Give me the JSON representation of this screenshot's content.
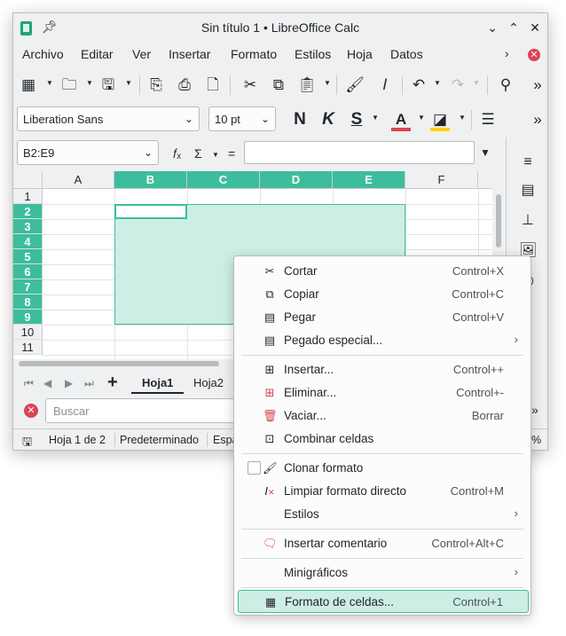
{
  "window": {
    "title": "Sin título 1 • LibreOffice Calc"
  },
  "menubar": {
    "items": [
      "Archivo",
      "Editar",
      "Ver",
      "Insertar",
      "Formato",
      "Estilos",
      "Hoja",
      "Datos"
    ]
  },
  "toolbar2": {
    "font_name": "Liberation Sans",
    "font_size": "10 pt"
  },
  "formulabar": {
    "name_box": "B2:E9",
    "formula": ""
  },
  "grid": {
    "columns": [
      "A",
      "B",
      "C",
      "D",
      "E",
      "F"
    ],
    "selected_columns": [
      "B",
      "C",
      "D",
      "E"
    ],
    "rows": [
      "1",
      "2",
      "3",
      "4",
      "5",
      "6",
      "7",
      "8",
      "9",
      "10",
      "11"
    ],
    "selected_rows": [
      "2",
      "3",
      "4",
      "5",
      "6",
      "7",
      "8",
      "9"
    ],
    "selection": "B2:E9"
  },
  "sheets": {
    "tabs": [
      "Hoja1",
      "Hoja2"
    ],
    "active": "Hoja1"
  },
  "findbar": {
    "placeholder": "Buscar"
  },
  "statusbar": {
    "sheet": "Hoja 1 de 2",
    "style": "Predeterminado",
    "language": "Espa",
    "zoom": "%"
  },
  "context_menu": {
    "items": [
      {
        "label": "Cortar",
        "shortcut": "Control+X",
        "icon": "scissors-icon"
      },
      {
        "label": "Copiar",
        "shortcut": "Control+C",
        "icon": "copy-icon"
      },
      {
        "label": "Pegar",
        "shortcut": "Control+V",
        "icon": "paste-icon"
      },
      {
        "label": "Pegado especial...",
        "shortcut": "",
        "icon": "paste-special-icon",
        "submenu": true
      },
      {
        "label": "Insertar...",
        "shortcut": "Control++",
        "icon": "insert-cells-icon"
      },
      {
        "label": "Eliminar...",
        "shortcut": "Control+-",
        "icon": "delete-cells-icon"
      },
      {
        "label": "Vaciar...",
        "shortcut": "Borrar",
        "icon": "trash-icon"
      },
      {
        "label": "Combinar celdas",
        "shortcut": "",
        "icon": "merge-cells-icon"
      },
      {
        "label": "Clonar formato",
        "shortcut": "",
        "icon": "paintbrush-icon",
        "checkbox": true
      },
      {
        "label": "Limpiar formato directo",
        "shortcut": "Control+M",
        "icon": "clear-format-icon"
      },
      {
        "label": "Estilos",
        "shortcut": "",
        "icon": "",
        "submenu": true
      },
      {
        "label": "Insertar comentario",
        "shortcut": "Control+Alt+C",
        "icon": "comment-icon"
      },
      {
        "label": "Minigráficos",
        "shortcut": "",
        "icon": "",
        "submenu": true
      },
      {
        "label": "Formato de celdas...",
        "shortcut": "Control+1",
        "icon": "format-cells-icon",
        "highlighted": true
      }
    ]
  },
  "colors": {
    "selection_accent": "#3dbd9c",
    "selection_fill": "#cdeee5",
    "close_red": "#da4453",
    "font_color": "#da4453",
    "highlight_color": "#ffd200"
  }
}
